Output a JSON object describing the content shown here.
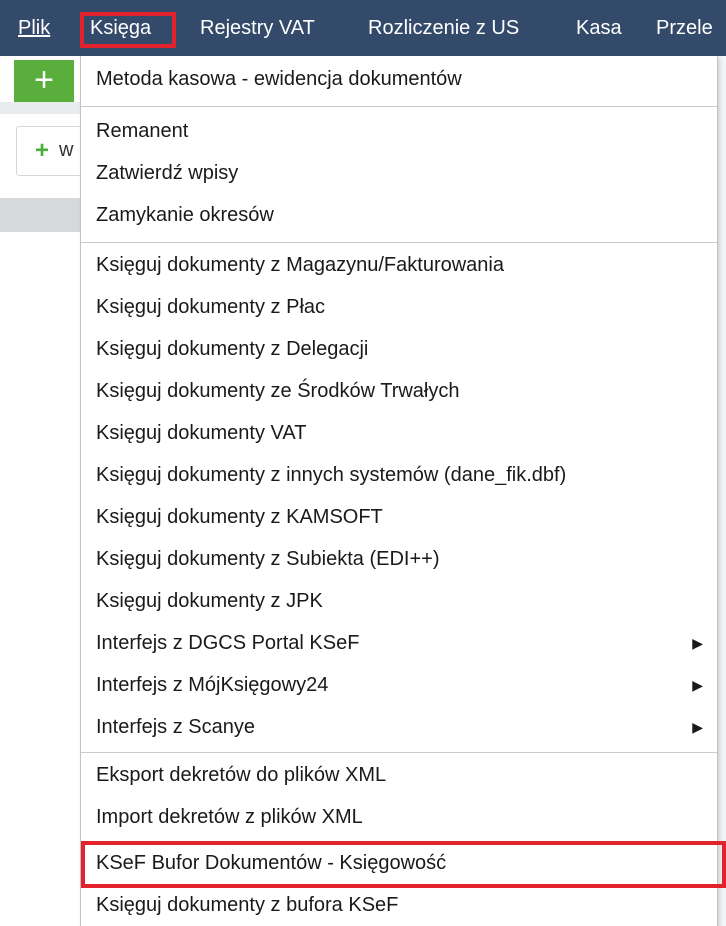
{
  "menubar": {
    "items": [
      "Plik",
      "Księga",
      "Rejestry VAT",
      "Rozliczenie z US",
      "Kasa",
      "Przele"
    ]
  },
  "toolbar": {
    "add_symbol": "+",
    "new_symbol": "+",
    "new_label_fragment": "w"
  },
  "dropdown": {
    "groups": [
      [
        "Metoda kasowa - ewidencja dokumentów"
      ],
      [
        "Remanent",
        "Zatwierdź wpisy",
        "Zamykanie okresów"
      ],
      [
        "Księguj dokumenty z Magazynu/Fakturowania",
        "Księguj dokumenty z Płac",
        "Księguj dokumenty z Delegacji",
        "Księguj dokumenty ze Środków Trwałych",
        "Księguj dokumenty VAT",
        "Księguj dokumenty z innych systemów (dane_fik.dbf)",
        "Księguj dokumenty z KAMSOFT",
        "Księguj dokumenty z Subiekta (EDI++)",
        "Księguj dokumenty z JPK",
        "Interfejs z DGCS Portal KSeF",
        "Interfejs z MójKsięgowy24",
        "Interfejs z Scanye"
      ],
      [
        "Eksport dekretów do plików XML",
        "Import dekretów z plików XML",
        "KSeF Bufor Dokumentów - Księgowość",
        "Księguj dokumenty z bufora KSeF"
      ]
    ],
    "submenu_arrow": "▶"
  },
  "colors": {
    "menubar_bg": "#344a6b",
    "highlight_border": "#e3232c",
    "add_button_bg": "#5aae3c"
  }
}
